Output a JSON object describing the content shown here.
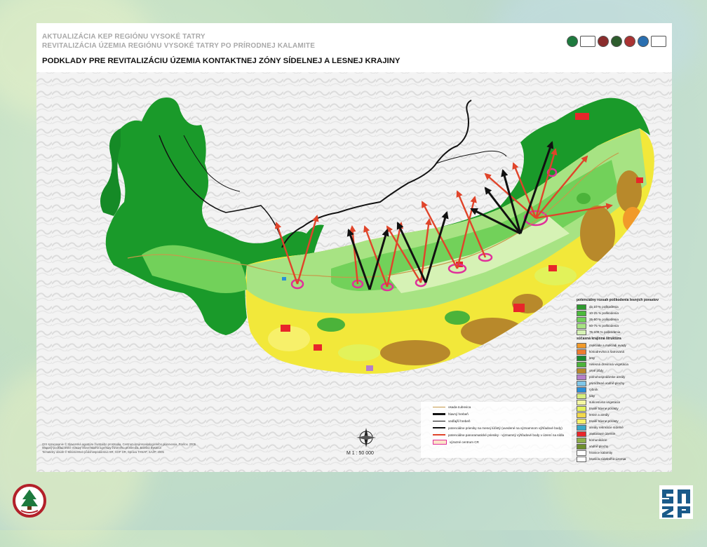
{
  "header": {
    "line1": "AKTUALIZÁCIA KEP REGIÓNU VYSOKÉ TATRY",
    "line2": "REVITALIZÁCIA ÚZEMIA REGIÓNU VYSOKÉ TATRY PO PRÍRODNEJ KALAMITE",
    "line3": "PODKLADY PRE REVITALIZÁCIU ÚZEMIA KONTAKTNEJ ZÓNY SÍDELNEJ A LESNEJ KRAJINY"
  },
  "legend": {
    "title_potential": "potenciálny rozsah poškodenia lesných porastov",
    "title_current": "súčasná krajinná štruktúra",
    "potential": [
      {
        "label": "do 10 % poškodenia",
        "color": "#2e9a2e"
      },
      {
        "label": "10-25 % poškodenia",
        "color": "#4cba3c"
      },
      {
        "label": "25-50 % poškodenia",
        "color": "#72d15a"
      },
      {
        "label": "50-75 % poškodenia",
        "color": "#a7e383"
      },
      {
        "label": "75-100 % poškodenia",
        "color": "#d6f2b5"
      }
    ],
    "current": [
      {
        "label": "mokrade a mokradi avady",
        "color": "#f19a2a"
      },
      {
        "label": "kosodrevina a šatrovaná",
        "color": "#ee7b2f"
      },
      {
        "label": "lesy",
        "color": "#1a8a2e"
      },
      {
        "label": "nelesná drevinná vegetácia",
        "color": "#4bb33a"
      },
      {
        "label": "orné pôdy",
        "color": "#b9892b"
      },
      {
        "label": "polnohospodárske areály",
        "color": "#b47fc9"
      },
      {
        "label": "prirodzené vodné plochy",
        "color": "#7fc6e8"
      },
      {
        "label": "rybník",
        "color": "#2a8fd8"
      },
      {
        "label": "lúky",
        "color": "#d7ee7e"
      },
      {
        "label": "sukcesívna vegetácia",
        "color": "#f3f7a2"
      },
      {
        "label": "trvalé trávne porasty",
        "color": "#e2f25a"
      },
      {
        "label": "lesné a areály",
        "color": "#f2d94c"
      },
      {
        "label": "trvalé trávne porasty",
        "color": "#f7f06a"
      },
      {
        "label": "areály rekreácie sídelné",
        "color": "#39a8c8"
      },
      {
        "label": "zastavané územie",
        "color": "#e8262a"
      },
      {
        "label": "komunikácie",
        "color": "#8fb04a"
      },
      {
        "label": "vodné plochy",
        "color": "#6e8f2e"
      },
      {
        "label": "hranice kalamity",
        "color": "#ffffff"
      },
      {
        "label": "hranica sídelného územia",
        "color": "#ffffff"
      }
    ],
    "lines": [
      {
        "label": "osada Ľubovica",
        "style": "thin"
      },
      {
        "label": "hlavný hrebeň",
        "style": "thick"
      },
      {
        "label": "vedľajší hrebeň",
        "style": "medium"
      },
      {
        "label": "potenciálne prieniky na menej lúčistý (uvedené na významnom výhľadové body)",
        "style": "arrow-black"
      },
      {
        "label": "potenciálne panoramatické prieniky - významný výhľadové body v území na sídla",
        "style": "arrow-red"
      },
      {
        "label": "výrazné centrum CR",
        "style": "pink"
      }
    ]
  },
  "credits": [
    "GIS spracovanie © Slovenská agentúra životného prostredia, Centrum krajinnoekologického plánovania, Prešov, 2005",
    "Mapový podklad lesné masivy Slovenského agentúry životného prostredia, Banská Bystrica",
    "Tematicky obsah © Ministerstvo pôdohospodárstva SR, SOP SR, Správa TANAP, SAŽP, 2005"
  ],
  "scale": "M 1 : 50 000",
  "colors": {
    "forest": "#1a9a2a",
    "forest_dark": "#138a22",
    "damage_light": "#a7e383",
    "yellow": "#f2e83a",
    "brown": "#b8892b",
    "red_arrow": "#e0442a",
    "black_arrow": "#111111",
    "pink": "#e0309a",
    "urban": "#e8262a"
  }
}
